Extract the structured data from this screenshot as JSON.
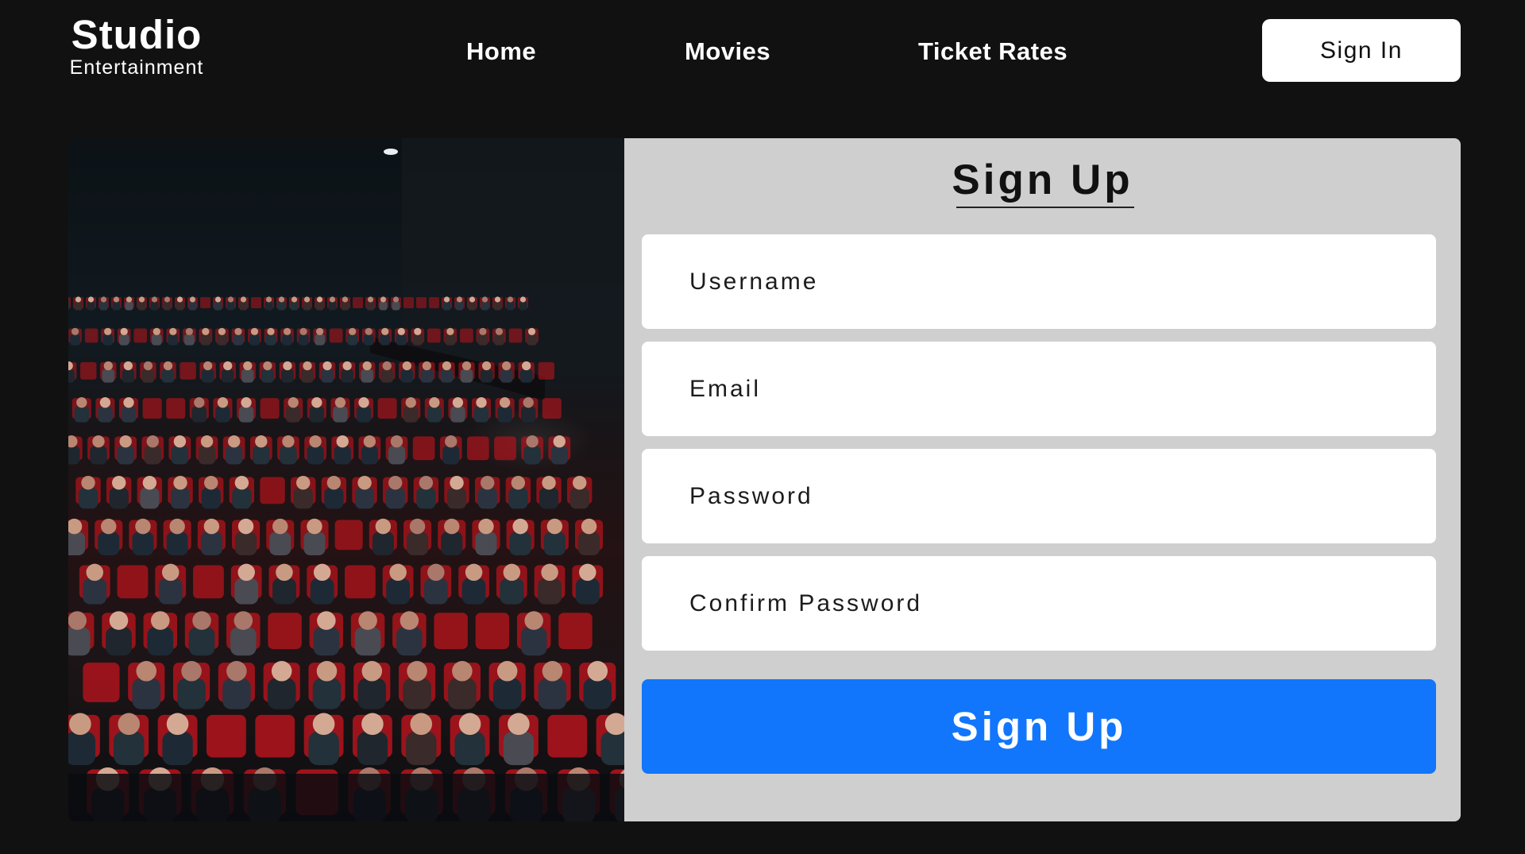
{
  "brand": {
    "name": "Studio",
    "tagline": "Entertainment"
  },
  "nav": {
    "home": "Home",
    "movies": "Movies",
    "ticket_rates": "Ticket Rates"
  },
  "header": {
    "signin_label": "Sign In"
  },
  "signup": {
    "title": "Sign Up",
    "username_placeholder": "Username",
    "email_placeholder": "Email",
    "password_placeholder": "Password",
    "confirm_password_placeholder": "Confirm Password",
    "submit_label": "Sign Up"
  },
  "colors": {
    "background": "#111111",
    "form_panel": "#cfcfcf",
    "primary_button": "#1176fb",
    "seat_red": "#b5141c"
  },
  "image": {
    "subject": "cinema-audience"
  }
}
